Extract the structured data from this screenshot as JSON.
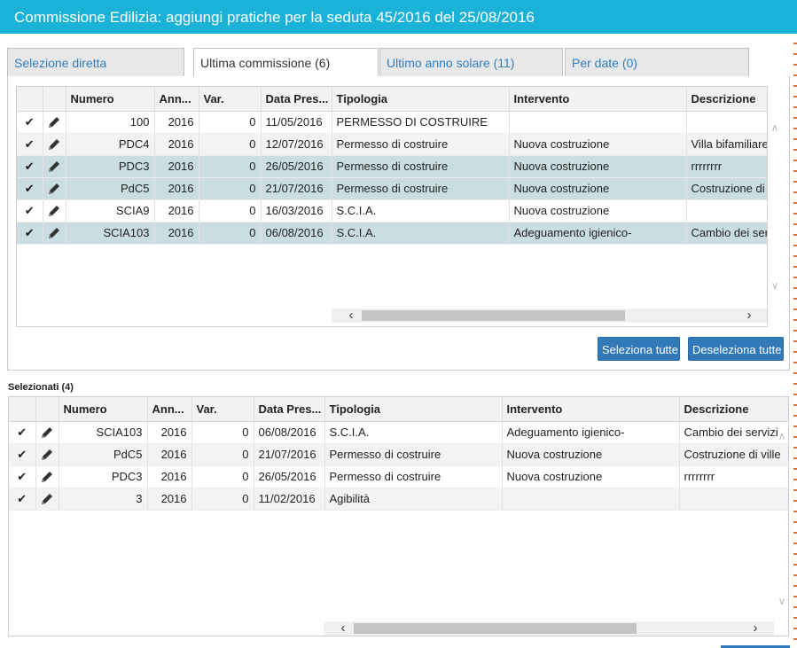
{
  "window": {
    "title": "Commissione Edilizia: aggiungi pratiche per la seduta 45/2016 del 25/08/2016"
  },
  "tabs": [
    {
      "label": "Selezione diretta",
      "active": false
    },
    {
      "label": "Ultima commissione (6)",
      "active": true
    },
    {
      "label": "Ultimo anno solare (11)",
      "active": false
    },
    {
      "label": "Per date (0)",
      "active": false
    }
  ],
  "columns": {
    "numero": "Numero",
    "anno": "Ann...",
    "var": "Var.",
    "data": "Data Pres...",
    "tipologia": "Tipologia",
    "intervento": "Intervento",
    "descrizione": "Descrizione"
  },
  "top_grid": {
    "rows": [
      {
        "selected": false,
        "numero": "100",
        "anno": "2016",
        "var": "0",
        "data": "11/05/2016",
        "tipologia": "PERMESSO DI COSTRUIRE",
        "intervento": "",
        "descrizione": ""
      },
      {
        "selected": false,
        "numero": "PDC4",
        "anno": "2016",
        "var": "0",
        "data": "12/07/2016",
        "tipologia": "Permesso di costruire",
        "intervento": "Nuova costruzione",
        "descrizione": "Villa bifamiliare"
      },
      {
        "selected": true,
        "numero": "PDC3",
        "anno": "2016",
        "var": "0",
        "data": "26/05/2016",
        "tipologia": "Permesso di costruire",
        "intervento": "Nuova costruzione",
        "descrizione": "rrrrrrrr"
      },
      {
        "selected": true,
        "numero": "PdC5",
        "anno": "2016",
        "var": "0",
        "data": "21/07/2016",
        "tipologia": "Permesso di costruire",
        "intervento": "Nuova costruzione",
        "descrizione": "Costruzione di"
      },
      {
        "selected": false,
        "numero": "SCIA9",
        "anno": "2016",
        "var": "0",
        "data": "16/03/2016",
        "tipologia": "S.C.I.A.",
        "intervento": "Nuova costruzione",
        "descrizione": ""
      },
      {
        "selected": true,
        "numero": "SCIA103",
        "anno": "2016",
        "var": "0",
        "data": "06/08/2016",
        "tipologia": "S.C.I.A.",
        "intervento": "Adeguamento igienico-",
        "descrizione": "Cambio dei ser"
      }
    ]
  },
  "buttons": {
    "select_all": "Seleziona tutte",
    "deselect_all": "Deseleziona tutte"
  },
  "selected_section": {
    "label": "Selezionati (4)",
    "rows": [
      {
        "numero": "SCIA103",
        "anno": "2016",
        "var": "0",
        "data": "06/08/2016",
        "tipologia": "S.C.I.A.",
        "intervento": "Adeguamento igienico-",
        "descrizione": "Cambio dei servizi"
      },
      {
        "numero": "PdC5",
        "anno": "2016",
        "var": "0",
        "data": "21/07/2016",
        "tipologia": "Permesso di costruire",
        "intervento": "Nuova costruzione",
        "descrizione": "Costruzione di ville"
      },
      {
        "numero": "PDC3",
        "anno": "2016",
        "var": "0",
        "data": "26/05/2016",
        "tipologia": "Permesso di costruire",
        "intervento": "Nuova costruzione",
        "descrizione": "rrrrrrrr"
      },
      {
        "numero": "3",
        "anno": "2016",
        "var": "0",
        "data": "11/02/2016",
        "tipologia": "Agibilità",
        "intervento": "",
        "descrizione": ""
      }
    ]
  },
  "icons": {
    "check": "check-icon",
    "edit": "pencil-icon"
  },
  "colors": {
    "titlebar": "#1ab2d6",
    "selected_row": "#c9dde2",
    "button": "#3179b9",
    "tab_link": "#2f7ec4"
  }
}
